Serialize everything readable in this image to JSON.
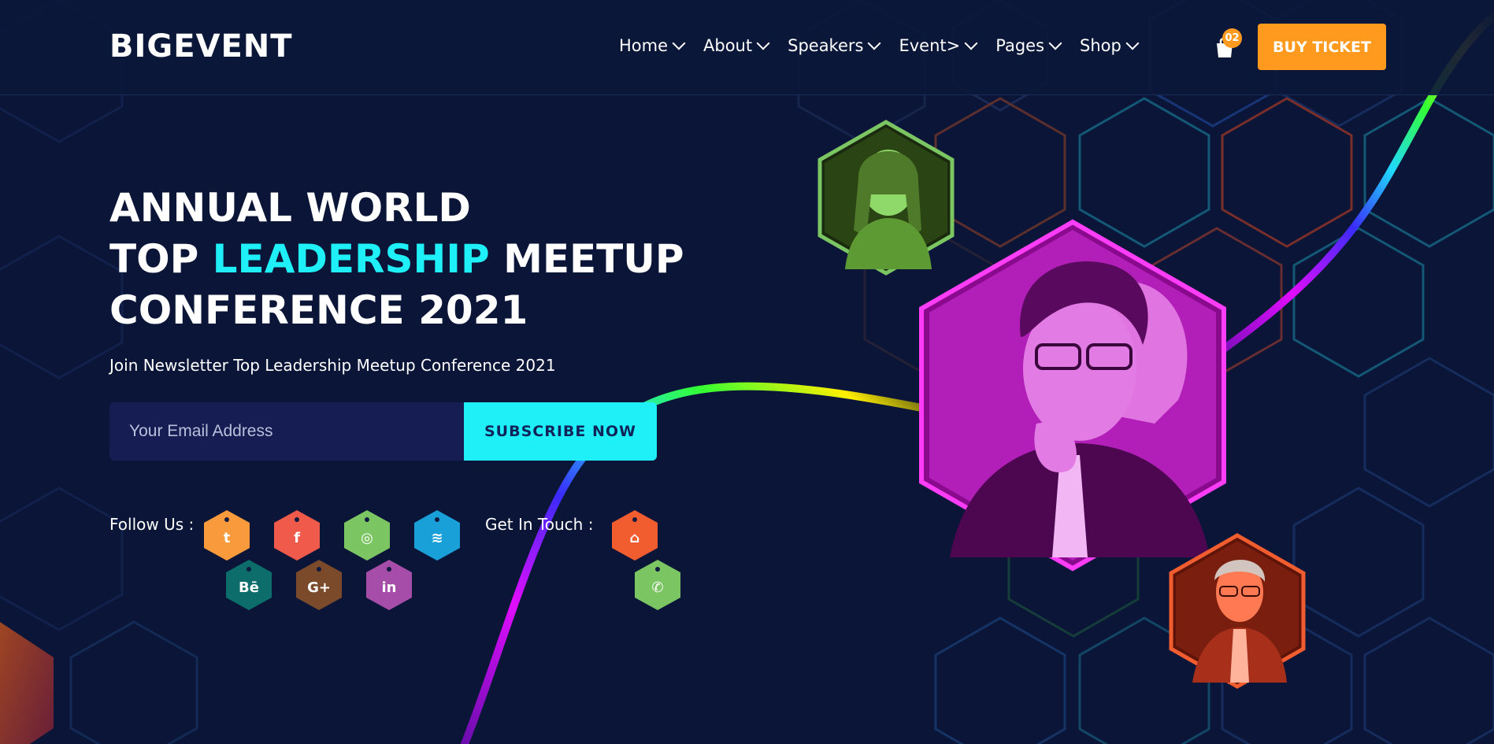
{
  "brand": {
    "logo": "BIGEVENT"
  },
  "nav": {
    "items": [
      {
        "label": "Home"
      },
      {
        "label": "About"
      },
      {
        "label": "Speakers"
      },
      {
        "label": "Event>"
      },
      {
        "label": "Pages"
      },
      {
        "label": "Shop"
      }
    ],
    "cart_count": "02",
    "cta_label": "BUY TICKET"
  },
  "hero": {
    "line1": "ANNUAL WORLD",
    "line2_pre": "TOP ",
    "line2_highlight": "LEADERSHIP",
    "line2_post": " MEETUP",
    "line3": "CONFERENCE 2021",
    "subtitle": "Join Newsletter Top Leadership Meetup Conference 2021",
    "email_placeholder": "Your Email Address",
    "subscribe_label": "SUBSCRIBE NOW"
  },
  "social": {
    "follow_label": "Follow Us :",
    "touch_label": "Get In Touch :",
    "icons": [
      {
        "name": "twitter-icon",
        "glyph": "t",
        "color": "#f99a3c"
      },
      {
        "name": "facebook-icon",
        "glyph": "f",
        "color": "#ef5a4a"
      },
      {
        "name": "dribbble-icon",
        "glyph": "◎",
        "color": "#7cc563"
      },
      {
        "name": "rss-icon",
        "glyph": "≋",
        "color": "#1aa0d8"
      },
      {
        "name": "behance-icon",
        "glyph": "Bē",
        "color": "#0d6d6a"
      },
      {
        "name": "google-plus-icon",
        "glyph": "G+",
        "color": "#7a4a2a"
      },
      {
        "name": "linkedin-icon",
        "glyph": "in",
        "color": "#a64ca9"
      }
    ],
    "contact_icons": [
      {
        "name": "home-icon",
        "glyph": "⌂",
        "color": "#f25d2f"
      },
      {
        "name": "phone-icon",
        "glyph": "✆",
        "color": "#7cc563"
      }
    ]
  },
  "colors": {
    "background": "#0a1538",
    "accent_cyan": "#1ff0f7",
    "accent_orange": "#ff9a1f",
    "speaker1_tint": "#7cc563",
    "speaker2_tint": "#ff3df7",
    "speaker3_tint": "#f25d2f"
  }
}
